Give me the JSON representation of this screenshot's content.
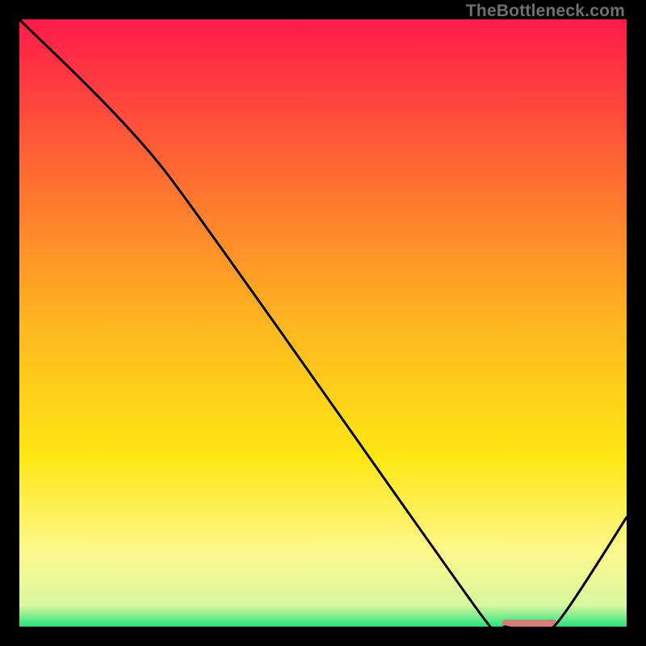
{
  "watermark": "TheBottleneck.com",
  "chart_data": {
    "type": "line",
    "title": "",
    "xlabel": "",
    "ylabel": "",
    "xlim": [
      0,
      100
    ],
    "ylim": [
      0,
      100
    ],
    "x": [
      0,
      24,
      76,
      80,
      88,
      100
    ],
    "values": [
      100,
      75,
      2,
      0,
      0,
      18
    ],
    "gradient_stops": [
      {
        "pos": 0.0,
        "color": "#ff1a4b"
      },
      {
        "pos": 0.25,
        "color": "#ff6a33"
      },
      {
        "pos": 0.5,
        "color": "#ffb61f"
      },
      {
        "pos": 0.72,
        "color": "#ffe714"
      },
      {
        "pos": 0.88,
        "color": "#fdf88e"
      },
      {
        "pos": 0.965,
        "color": "#d8f7a0"
      },
      {
        "pos": 1.0,
        "color": "#23e37a"
      }
    ],
    "marker": {
      "x0": 79.5,
      "x1": 88.5,
      "y": 0.5,
      "color": "#d87a7a"
    }
  }
}
